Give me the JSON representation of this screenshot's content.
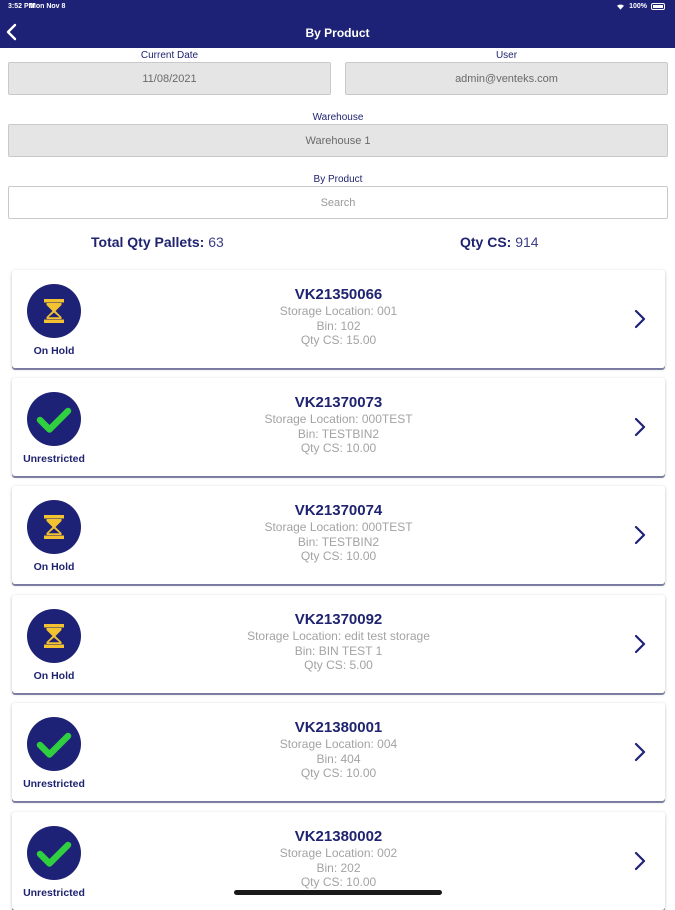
{
  "status_bar": {
    "time": "3:52 PM",
    "date": "Mon Nov 8",
    "battery": "100%"
  },
  "nav": {
    "title": "By Product",
    "back_icon": "chevron-left-icon"
  },
  "form": {
    "current_date_label": "Current Date",
    "current_date_value": "11/08/2021",
    "user_label": "User",
    "user_value": "admin@venteks.com",
    "warehouse_label": "Warehouse",
    "warehouse_value": "Warehouse 1",
    "product_label": "By Product",
    "search_placeholder": "Search"
  },
  "totals": {
    "pallets_label": "Total Qty Pallets:",
    "pallets_value": "63",
    "cs_label": "Qty CS:",
    "cs_value": "914"
  },
  "colors": {
    "navy": "#1e2277",
    "hold": "#f2c230",
    "ok": "#2fcf3f"
  },
  "items": [
    {
      "status": "On Hold",
      "status_icon": "hourglass-icon",
      "id": "VK21350066",
      "location": "Storage Location: 001",
      "bin": "Bin: 102",
      "qty": "Qty CS: 15.00"
    },
    {
      "status": "Unrestricted",
      "status_icon": "checkmark-icon",
      "id": "VK21370073",
      "location": "Storage Location: 000TEST",
      "bin": "Bin: TESTBIN2",
      "qty": "Qty CS: 10.00"
    },
    {
      "status": "On Hold",
      "status_icon": "hourglass-icon",
      "id": "VK21370074",
      "location": "Storage Location: 000TEST",
      "bin": "Bin: TESTBIN2",
      "qty": "Qty CS: 10.00"
    },
    {
      "status": "On Hold",
      "status_icon": "hourglass-icon",
      "id": "VK21370092",
      "location": "Storage Location: edit test storage",
      "bin": "Bin: BIN TEST 1",
      "qty": "Qty CS: 5.00"
    },
    {
      "status": "Unrestricted",
      "status_icon": "checkmark-icon",
      "id": "VK21380001",
      "location": "Storage Location: 004",
      "bin": "Bin: 404",
      "qty": "Qty CS: 10.00"
    },
    {
      "status": "Unrestricted",
      "status_icon": "checkmark-icon",
      "id": "VK21380002",
      "location": "Storage Location: 002",
      "bin": "Bin: 202",
      "qty": "Qty CS: 10.00"
    }
  ]
}
